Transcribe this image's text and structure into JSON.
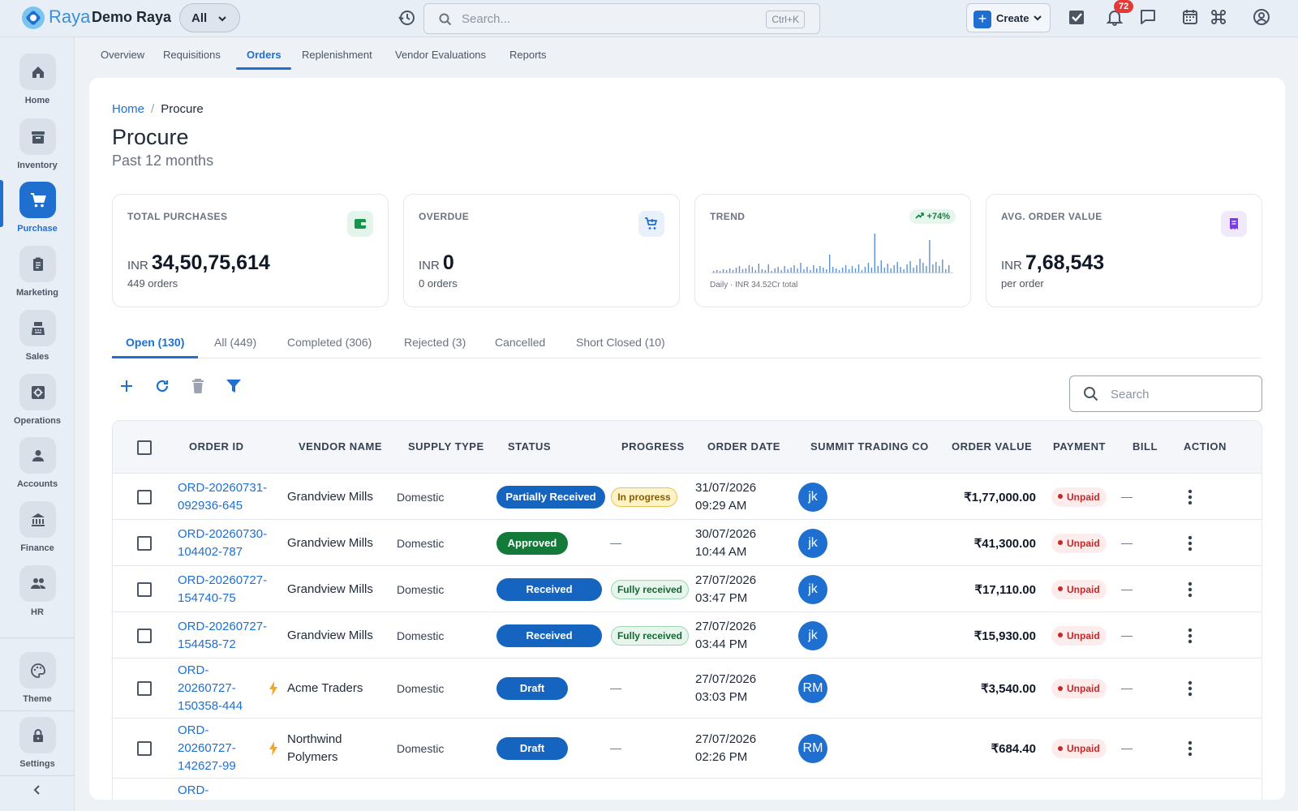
{
  "topbar": {
    "brand": "Raya",
    "org": "Demo Raya",
    "scope": "All",
    "search_placeholder": "Search...",
    "search_shortcut": "Ctrl+K",
    "create_label": "Create",
    "notif_count": "72"
  },
  "leftnav": {
    "items": [
      {
        "label": "Home",
        "icon": "home-icon"
      },
      {
        "label": "Inventory",
        "icon": "inventory-icon"
      },
      {
        "label": "Purchase",
        "icon": "cart-icon",
        "active": true
      },
      {
        "label": "Marketing",
        "icon": "clipboard-icon"
      },
      {
        "label": "Sales",
        "icon": "register-icon"
      },
      {
        "label": "Operations",
        "icon": "gear-icon"
      },
      {
        "label": "Accounts",
        "icon": "person-icon"
      },
      {
        "label": "Finance",
        "icon": "bank-icon"
      },
      {
        "label": "HR",
        "icon": "people-icon"
      }
    ],
    "theme_label": "Theme",
    "settings_label": "Settings"
  },
  "subtabs": [
    "Overview",
    "Requisitions",
    "Orders",
    "Replenishment",
    "Vendor Evaluations",
    "Reports"
  ],
  "subtab_active": "Orders",
  "breadcrumb": {
    "home": "Home",
    "sep": "/",
    "current": "Procure"
  },
  "page": {
    "title": "Procure",
    "subtitle": "Past 12 months"
  },
  "kpis": {
    "total": {
      "label": "TOTAL PURCHASES",
      "currency": "INR",
      "value": "34,50,75,614",
      "sub": "449 orders"
    },
    "overdue": {
      "label": "OVERDUE",
      "currency": "INR",
      "value": "0",
      "sub": "0 orders"
    },
    "trend": {
      "label": "TREND",
      "badge": "+74%",
      "caption": "Daily · INR 34.52Cr total"
    },
    "avg": {
      "label": "AVG. ORDER VALUE",
      "currency": "INR",
      "value": "7,68,543",
      "sub": "per order"
    }
  },
  "order_tabs": [
    "Open (130)",
    "All (449)",
    "Completed (306)",
    "Rejected (3)",
    "Cancelled",
    "Short Closed (10)"
  ],
  "table_search_placeholder": "Search",
  "columns": [
    "ORDER ID",
    "VENDOR NAME",
    "SUPPLY TYPE",
    "STATUS",
    "PROGRESS",
    "ORDER DATE",
    "SUMMIT TRADING CO",
    "ORDER VALUE",
    "PAYMENT",
    "BILL",
    "ACTION"
  ],
  "rows": [
    {
      "id": [
        "ORD-20260731-",
        "092936-645"
      ],
      "vendor": [
        "Grandview Mills"
      ],
      "supply": "Domestic",
      "status": "Partially Received",
      "status_color": "#1565c0",
      "progress": "In progress",
      "progress_style": "warn",
      "date": "31/07/2026",
      "time": "09:29 AM",
      "avatar": "jk",
      "value": "₹1,77,000.00",
      "payment": "Unpaid",
      "bill": "—",
      "bolt": false
    },
    {
      "id": [
        "ORD-20260730-",
        "104402-787"
      ],
      "vendor": [
        "Grandview Mills"
      ],
      "supply": "Domestic",
      "status": "Approved",
      "status_color": "#137a3a",
      "progress": "—",
      "progress_style": "none",
      "date": "30/07/2026",
      "time": "10:44 AM",
      "avatar": "jk",
      "value": "₹41,300.00",
      "payment": "Unpaid",
      "bill": "—",
      "bolt": false
    },
    {
      "id": [
        "ORD-20260727-",
        "154740-75"
      ],
      "vendor": [
        "Grandview Mills"
      ],
      "supply": "Domestic",
      "status": "Received",
      "status_color": "#1565c0",
      "progress": "Fully received",
      "progress_style": "ok",
      "date": "27/07/2026",
      "time": "03:47 PM",
      "avatar": "jk",
      "value": "₹17,110.00",
      "payment": "Unpaid",
      "bill": "—",
      "bolt": false
    },
    {
      "id": [
        "ORD-20260727-",
        "154458-72"
      ],
      "vendor": [
        "Grandview Mills"
      ],
      "supply": "Domestic",
      "status": "Received",
      "status_color": "#1565c0",
      "progress": "Fully received",
      "progress_style": "ok",
      "date": "27/07/2026",
      "time": "03:44 PM",
      "avatar": "jk",
      "value": "₹15,930.00",
      "payment": "Unpaid",
      "bill": "—",
      "bolt": false
    },
    {
      "id": [
        "ORD-",
        "20260727-",
        "150358-444"
      ],
      "vendor": [
        "Acme Traders"
      ],
      "supply": "Domestic",
      "status": "Draft",
      "status_color": "#1565c0",
      "progress": "—",
      "progress_style": "none",
      "date": "27/07/2026",
      "time": "03:03 PM",
      "avatar": "RM",
      "value": "₹3,540.00",
      "payment": "Unpaid",
      "bill": "—",
      "bolt": true
    },
    {
      "id": [
        "ORD-",
        "20260727-",
        "142627-99"
      ],
      "vendor": [
        "Northwind",
        "Polymers"
      ],
      "supply": "Domestic",
      "status": "Draft",
      "status_color": "#1565c0",
      "progress": "—",
      "progress_style": "none",
      "date": "27/07/2026",
      "time": "02:26 PM",
      "avatar": "RM",
      "value": "₹684.40",
      "payment": "Unpaid",
      "bill": "—",
      "bolt": true
    }
  ],
  "partial_row_id": "ORD-"
}
